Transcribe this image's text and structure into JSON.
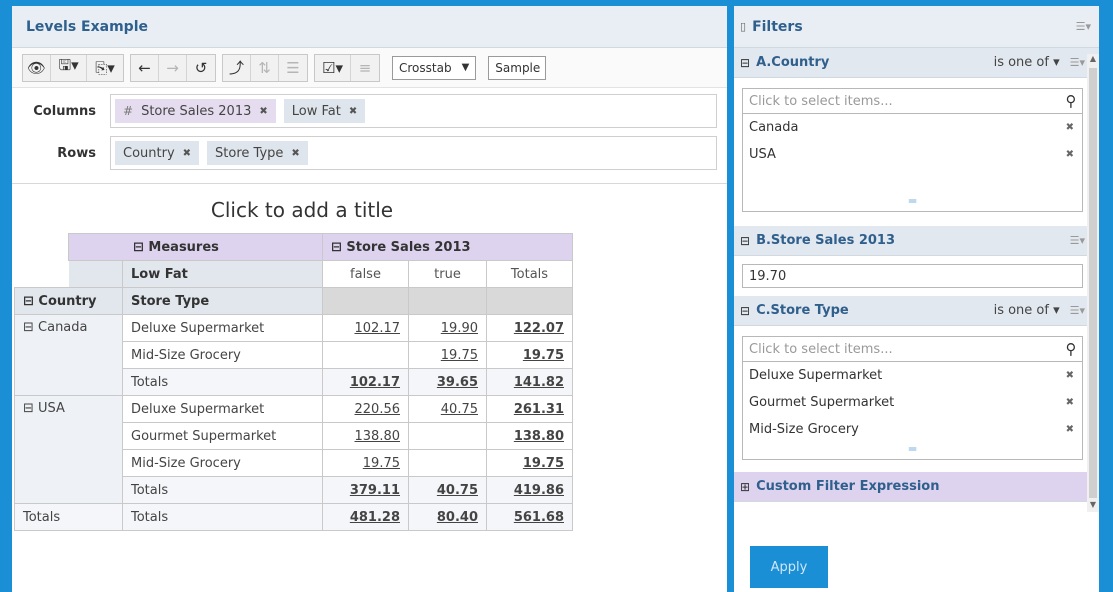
{
  "colors": {
    "frame": "#1a8fd6",
    "accent_title": "#2f5f8c",
    "measure_bg": "#ddd3ee",
    "dim_bg": "#e2e7ee"
  },
  "header": {
    "title": "Levels Example"
  },
  "toolbar": {
    "view_mode": "Crosstab",
    "view_mode_arrow": "▼",
    "datasource": "Sample D",
    "icons": [
      "eye-icon",
      "save-icon",
      "export-icon",
      "undo-icon",
      "redo-icon",
      "reset-icon",
      "swap-axes-icon",
      "sort-icon",
      "totals-icon",
      "select-icon",
      "filter-icon"
    ]
  },
  "columns_label": "Columns",
  "rows_label": "Rows",
  "columns": [
    {
      "hash": "#",
      "label": "Store Sales 2013",
      "x": "✖"
    },
    {
      "label": "Low Fat",
      "x": "✖"
    }
  ],
  "rows": [
    {
      "label": "Country",
      "x": "✖"
    },
    {
      "label": "Store Type",
      "x": "✖"
    }
  ],
  "report_title": "Click to add a title",
  "crosstab": {
    "measures_hdr": "⊟  Measures",
    "store_sales_hdr": "⊟  Store Sales 2013",
    "low_fat_hdr": "Low Fat",
    "col_false": "false",
    "col_true": "true",
    "col_totals": "Totals",
    "country_hdr": "⊟  Country",
    "storetype_hdr": "Store Type",
    "canada": "⊟  Canada",
    "usa": "⊟  USA",
    "totals": "Totals",
    "rows": [
      {
        "type": "Deluxe Supermarket",
        "f": "102.17",
        "t": "19.90",
        "tot": "122.07"
      },
      {
        "type": "Mid-Size Grocery",
        "f": "",
        "t": "19.75",
        "tot": "19.75"
      },
      {
        "type": "Totals",
        "f": "102.17",
        "t": "39.65",
        "tot": "141.82"
      },
      {
        "type": "Deluxe Supermarket",
        "f": "220.56",
        "t": "40.75",
        "tot": "261.31"
      },
      {
        "type": "Gourmet Supermarket",
        "f": "138.80",
        "t": "",
        "tot": "138.80"
      },
      {
        "type": "Mid-Size Grocery",
        "f": "19.75",
        "t": "",
        "tot": "19.75"
      },
      {
        "type": "Totals",
        "f": "379.11",
        "t": "40.75",
        "tot": "419.86"
      },
      {
        "type": "Totals",
        "f": "481.28",
        "t": "80.40",
        "tot": "561.68"
      }
    ]
  },
  "filters": {
    "title": "Filters",
    "country": {
      "name": "A.Country",
      "op": "is one of ▾",
      "placeholder": "Click to select items...",
      "items": [
        "Canada",
        "USA"
      ]
    },
    "sales": {
      "name": "B.Store Sales 2013",
      "value": "19.70"
    },
    "storetype": {
      "name": "C.Store Type",
      "op": "is one of ▾",
      "placeholder": "Click to select items...",
      "items": [
        "Deluxe Supermarket",
        "Gourmet Supermarket",
        "Mid-Size Grocery"
      ]
    },
    "custom": {
      "name": "Custom Filter Expression"
    },
    "apply": "Apply"
  }
}
